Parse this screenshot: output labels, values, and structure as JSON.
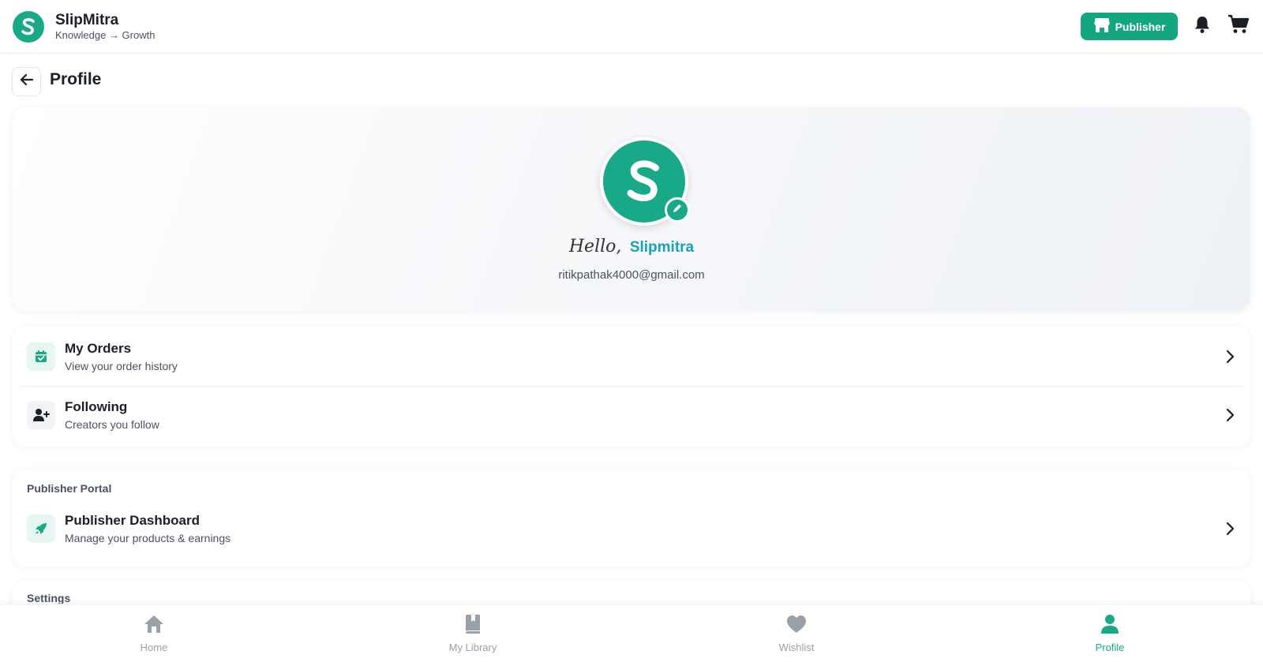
{
  "header": {
    "brand_name": "SlipMitra",
    "brand_tagline": "Knowledge → Growth",
    "publisher_label": "Publisher",
    "icons": [
      "store-icon",
      "bell-icon",
      "cart-icon"
    ]
  },
  "page": {
    "title": "Profile"
  },
  "profile": {
    "greeting": "Hello,",
    "name": "Slipmitra",
    "email": "ritikpathak4000@gmail.com"
  },
  "menu": {
    "orders": {
      "title": "My Orders",
      "subtitle": "View your order history",
      "icon": "calendar-check-icon"
    },
    "following": {
      "title": "Following",
      "subtitle": "Creators you follow",
      "icon": "user-plus-icon"
    }
  },
  "publisher_portal": {
    "label": "Publisher Portal",
    "dashboard": {
      "title": "Publisher Dashboard",
      "subtitle": "Manage your products & earnings",
      "icon": "rocket-icon"
    }
  },
  "settings": {
    "label": "Settings"
  },
  "bottom_nav": {
    "items": [
      {
        "label": "Home",
        "icon": "home-icon"
      },
      {
        "label": "My Library",
        "icon": "book-icon"
      },
      {
        "label": "Wishlist",
        "icon": "heart-icon"
      },
      {
        "label": "Profile",
        "icon": "user-icon",
        "active": true
      }
    ]
  },
  "colors": {
    "accent": "#1aa988",
    "name_highlight": "#17a2b8",
    "inactive_nav": "#9aa0a8"
  }
}
